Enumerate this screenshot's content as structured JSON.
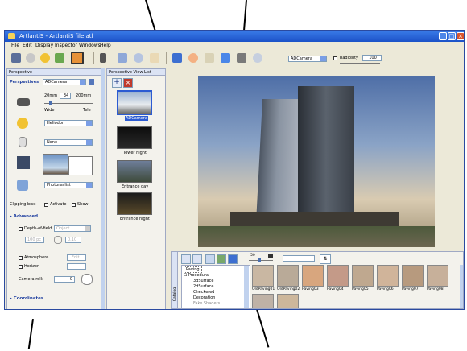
{
  "window": {
    "title": "ArtlantiS - ArtlantiS file.atl"
  },
  "menu": [
    "File",
    "Edit",
    "Display",
    "Inspector",
    "Windows",
    "Help"
  ],
  "toolbar": {
    "camera_select": "ADCamera",
    "radiosity_label": "Radiosity",
    "radiosity_value": "100"
  },
  "left_panel": {
    "header": "Perspective",
    "perspectives_label": "Perspectives",
    "camera_value": "ADCamera",
    "focal": {
      "min": "20mm",
      "value": "34",
      "max": "200mm",
      "wide": "Wide",
      "tele": "Tele"
    },
    "sun_select": "Heliodon",
    "light_select": "None",
    "render_select": "Photorealist",
    "clipping_label": "Clipping box:",
    "activate_label": "Activate",
    "show_label": "Show",
    "advanced_label": "Advanced",
    "dof_label": "Depth-of-field",
    "dof_select": "Object",
    "dof_distance": "100 pc",
    "dof_value": "0.10",
    "atmosphere_label": "Atmosphere",
    "atmosphere_edit": "Edit...",
    "horizon_label": "Horizon",
    "camera_roll_label": "Camera roll:",
    "camera_roll_value": "0",
    "coordinates_label": "Coordinates"
  },
  "view_list": {
    "header": "Perspective View List",
    "items": [
      {
        "label": "ADCamera"
      },
      {
        "label": "Tower night"
      },
      {
        "label": "Entrance day"
      },
      {
        "label": "Entrance night"
      }
    ]
  },
  "catalog": {
    "side_label": "Catalog",
    "slider_value": "50",
    "tree": [
      "Paving",
      "Procedural",
      "3dSurface",
      "2dSurface",
      "Checkered",
      "Decoration",
      "Fake Shaders"
    ],
    "tiles": [
      {
        "label": "OldPaving01",
        "color": "#c9b7a2"
      },
      {
        "label": "OldPaving02",
        "color": "#b9aa98"
      },
      {
        "label": "Paving03",
        "color": "#d8a67e"
      },
      {
        "label": "Paving04",
        "color": "#c49a88"
      },
      {
        "label": "Paving05",
        "color": "#bfa88f"
      },
      {
        "label": "Paving06",
        "color": "#d0b49a"
      },
      {
        "label": "Paving07",
        "color": "#b79a7e"
      },
      {
        "label": "Paving08",
        "color": "#c7b09a"
      }
    ]
  },
  "colors": {
    "title_bar": "#2a5fd8",
    "panel_header": "#dbe3f4",
    "accent_red": "#c0392b"
  }
}
